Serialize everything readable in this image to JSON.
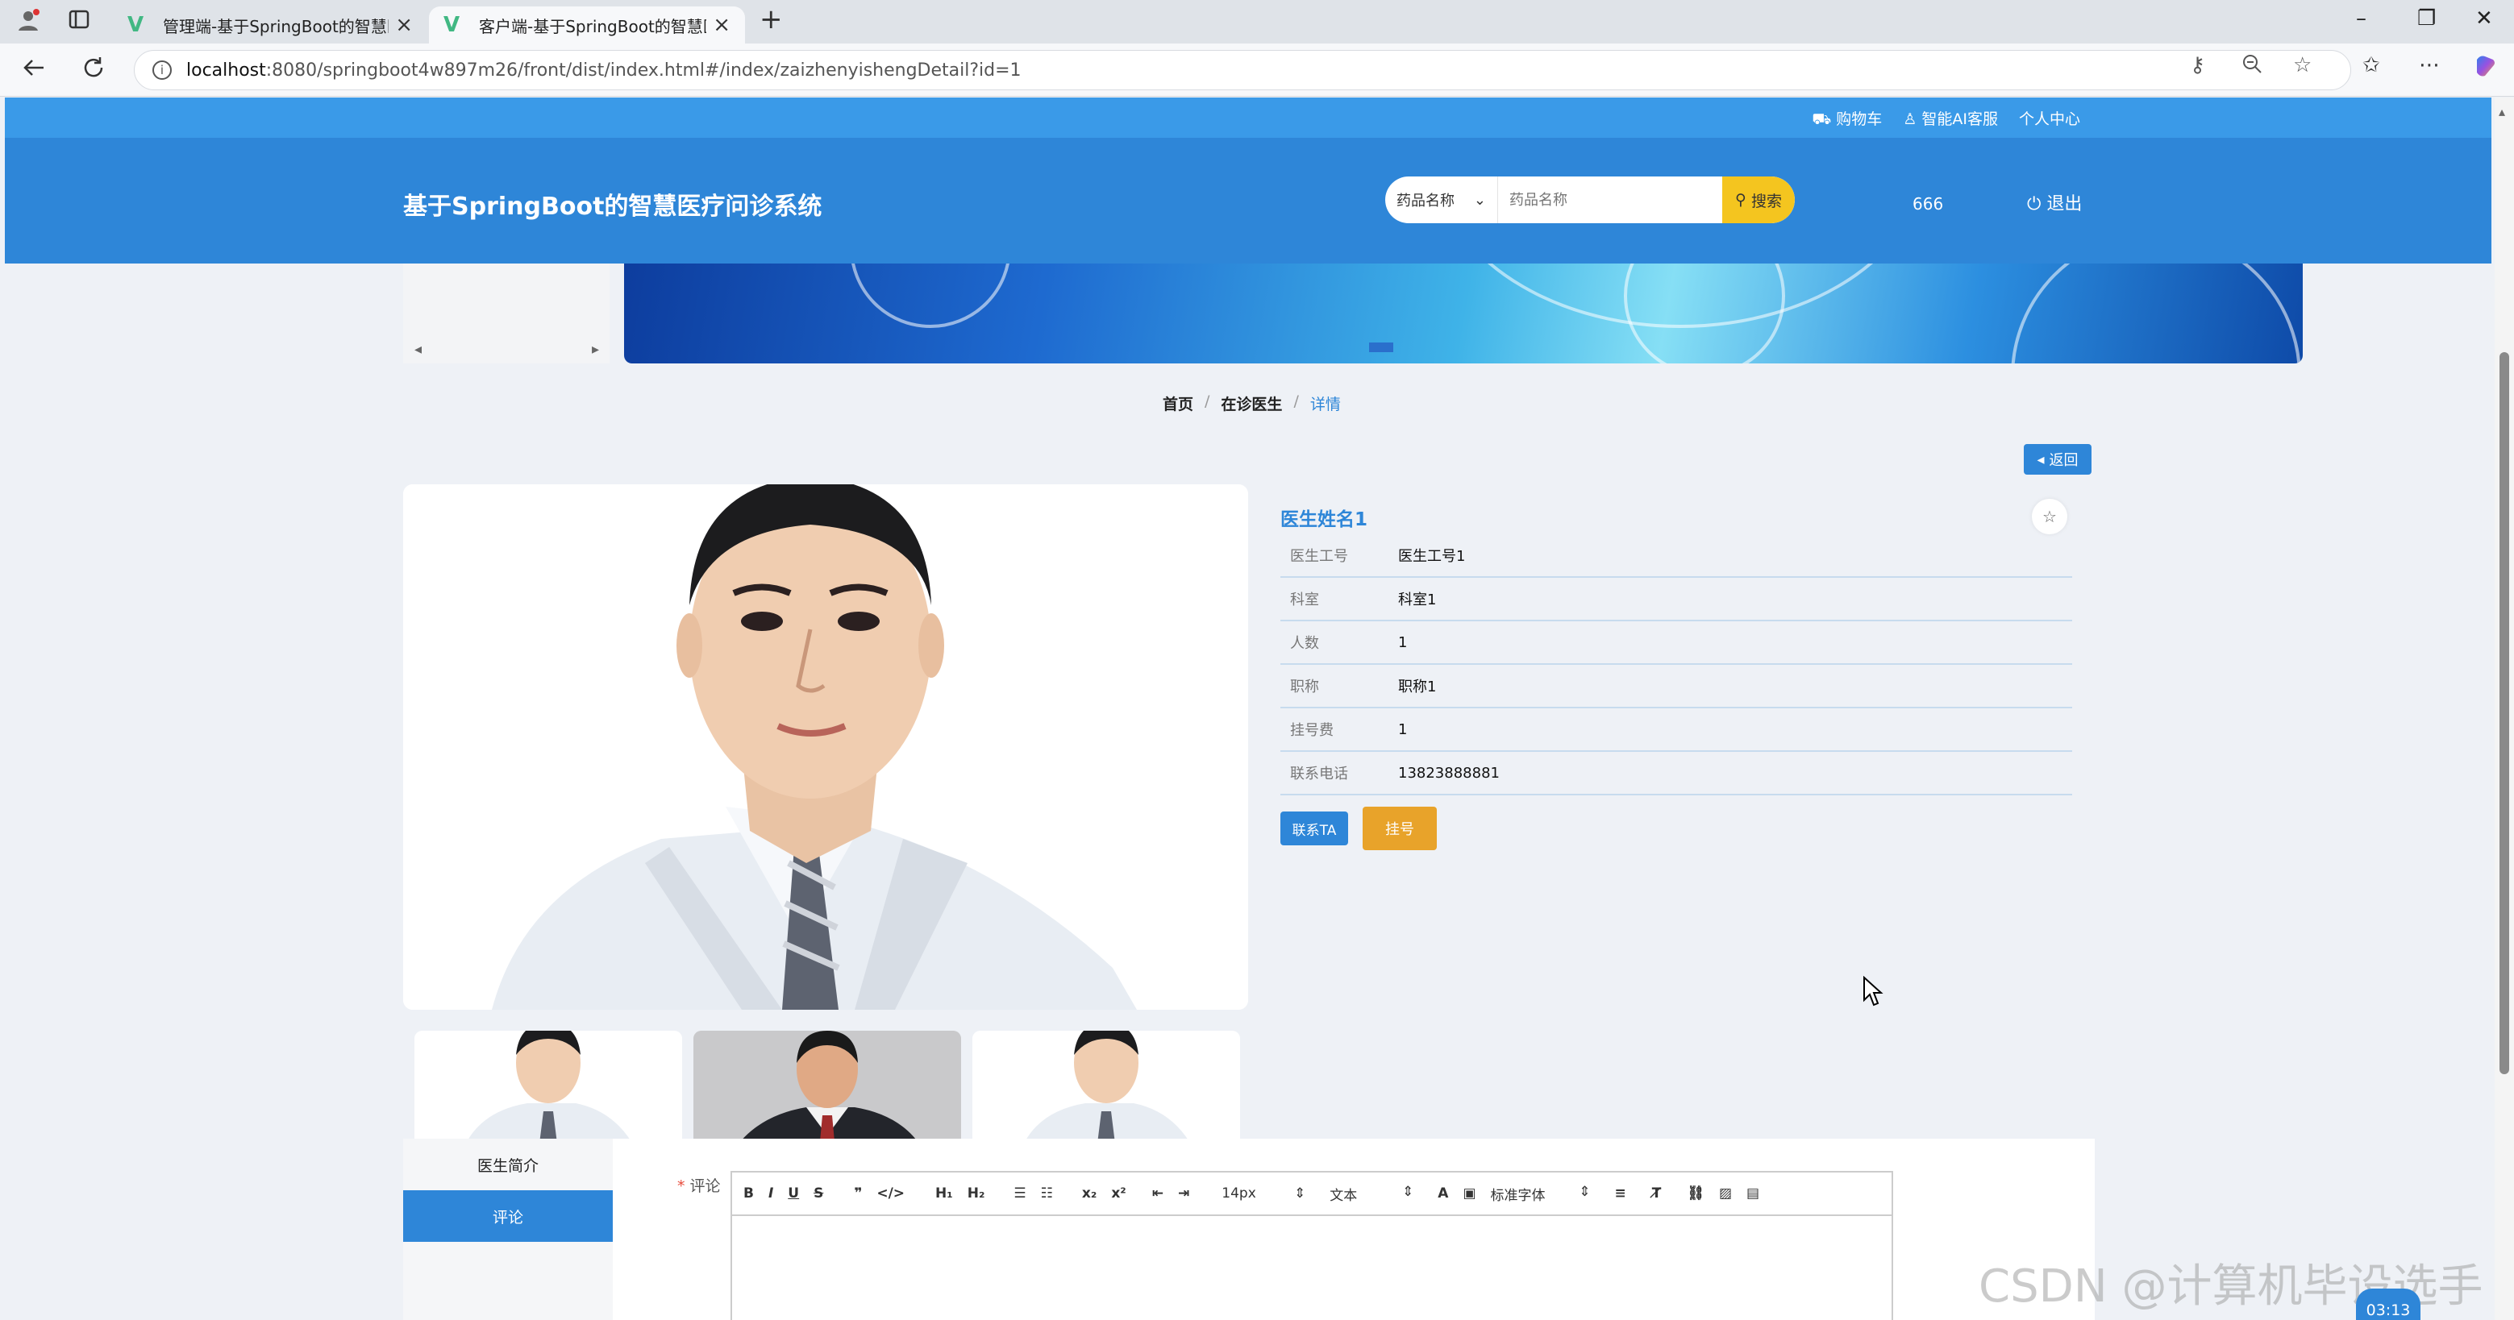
{
  "browser": {
    "tabs": [
      {
        "title": "管理端-基于SpringBoot的智慧医",
        "active": false
      },
      {
        "title": "客户端-基于SpringBoot的智慧医",
        "active": true
      }
    ],
    "url_host": "localhost",
    "url_path": ":8080/springboot4w897m26/front/dist/index.html#/index/zaizhenyishengDetail?id=1"
  },
  "topbar": {
    "links": [
      "购物车",
      "智能AI客服",
      "个人中心"
    ]
  },
  "header": {
    "site_title": "基于SpringBoot的智慧医疗问诊系统",
    "search_select": "药品名称",
    "search_placeholder": "药品名称",
    "search_button": "搜索",
    "username": "666",
    "logout": "退出"
  },
  "breadcrumb": {
    "home": "首页",
    "section": "在诊医生",
    "current": "详情",
    "separator": "/"
  },
  "back_button": "返回",
  "doctor": {
    "name": "医生姓名1",
    "fields": [
      {
        "label": "医生工号",
        "value": "医生工号1"
      },
      {
        "label": "科室",
        "value": "科室1"
      },
      {
        "label": "人数",
        "value": "1"
      },
      {
        "label": "职称",
        "value": "职称1"
      },
      {
        "label": "挂号费",
        "value": "1"
      },
      {
        "label": "联系电话",
        "value": "13823888881"
      }
    ],
    "contact_button": "联系TA",
    "book_button": "挂号"
  },
  "tabs": {
    "intro": "医生简介",
    "comment": "评论"
  },
  "comment": {
    "required_mark": "*",
    "label": "评论",
    "toolbar": {
      "font_size": "14px",
      "text_type": "文本",
      "font_family": "标准字体"
    }
  },
  "watermark": "CSDN @计算机毕设选手",
  "timer": "03:13",
  "colors": {
    "primary": "#2e86d8",
    "topstrip": "#3a9ae8",
    "search_button": "#f4c51f",
    "book_button": "#e8a32a"
  }
}
